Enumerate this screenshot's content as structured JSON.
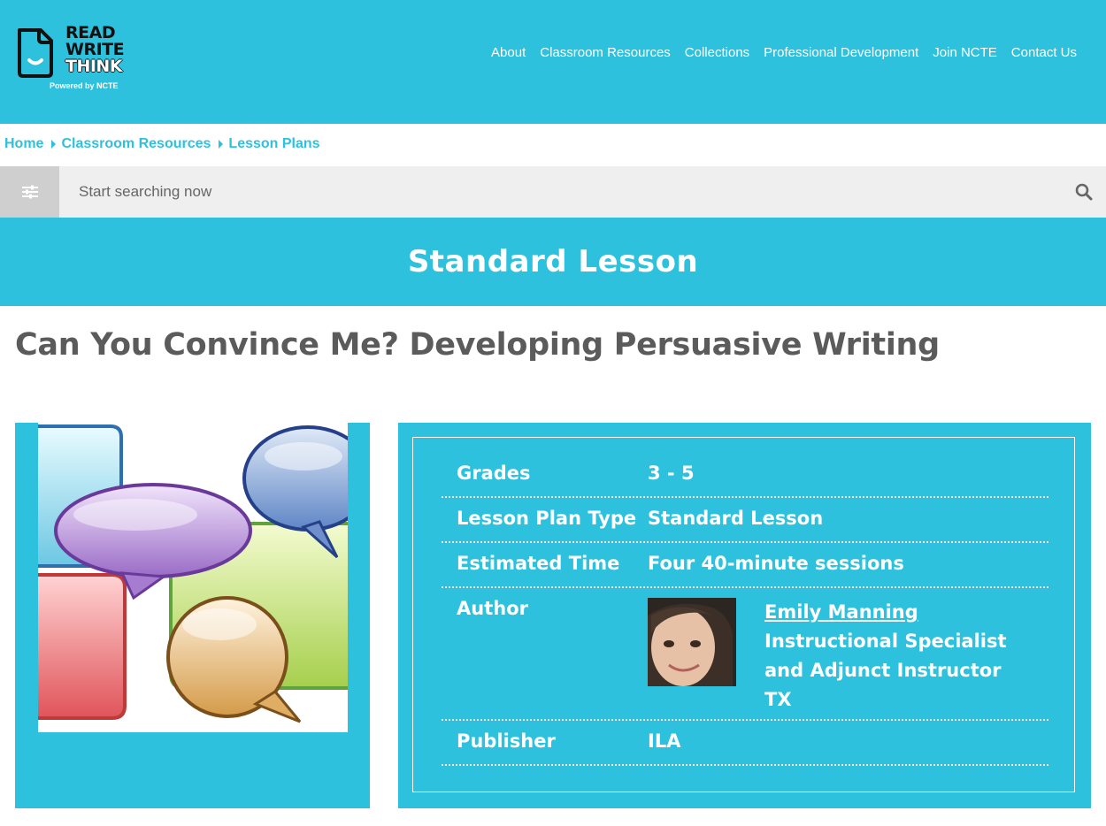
{
  "brand": {
    "logo_lines": [
      "READ",
      "WRITE",
      "THINK"
    ],
    "powered_by": "Powered by NCTE"
  },
  "nav": [
    "About",
    "Classroom Resources",
    "Collections",
    "Professional Development",
    "Join NCTE",
    "Contact Us"
  ],
  "breadcrumb": [
    "Home",
    "Classroom Resources",
    "Lesson Plans"
  ],
  "search": {
    "placeholder": "Start searching now"
  },
  "lesson_type_banner": "Standard Lesson",
  "page_title": "Can You Convince Me? Developing Persuasive Writing",
  "details": {
    "grades_label": "Grades",
    "grades_value": "3 - 5",
    "type_label": "Lesson Plan Type",
    "type_value": "Standard Lesson",
    "time_label": "Estimated Time",
    "time_value": "Four 40-minute sessions",
    "author_label": "Author",
    "author_name": "Emily Manning",
    "author_title_1": "Instructional Specialist",
    "author_title_2": "and Adjunct Instructor",
    "author_location": "TX",
    "publisher_label": "Publisher",
    "publisher_value": "ILA"
  },
  "icons": [
    "logo-doc-icon",
    "filter-sliders-icon",
    "search-icon",
    "breadcrumb-arrow-icon"
  ],
  "colors": {
    "brand": "#2ec1de",
    "title_gray": "#5b5b5b",
    "search_bg": "#efefef",
    "filter_bg": "#cfcfcf"
  }
}
